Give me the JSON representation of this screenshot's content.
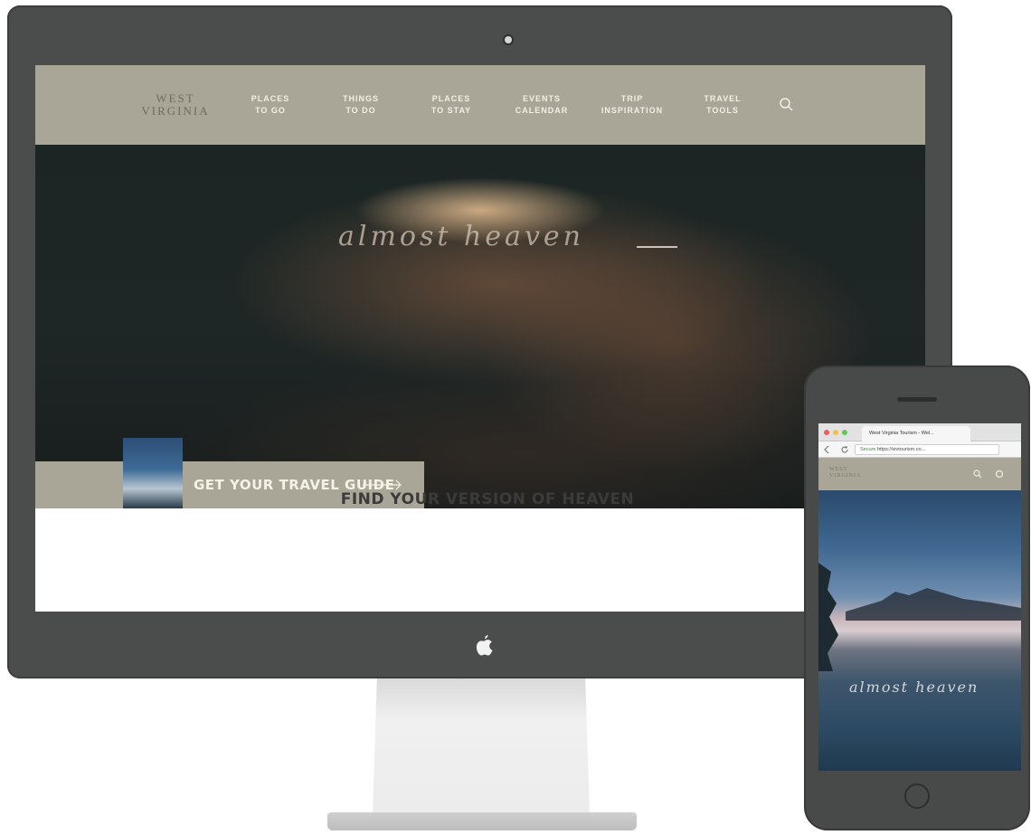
{
  "desktop": {
    "nav": {
      "logo_line1": "WEST",
      "logo_line2": "VIRGINIA",
      "items": [
        {
          "line1": "PLACES",
          "line2": "TO GO"
        },
        {
          "line1": "THINGS",
          "line2": "TO DO"
        },
        {
          "line1": "PLACES",
          "line2": "TO STAY"
        },
        {
          "line1": "EVENTS",
          "line2": "CALENDAR"
        },
        {
          "line1": "TRIP",
          "line2": "INSPIRATION"
        },
        {
          "line1": "TRAVEL",
          "line2": "TOOLS"
        }
      ],
      "search_icon": "search-icon"
    },
    "hero": {
      "script_text": "almost heaven"
    },
    "travel_guide": {
      "label": "GET YOUR TRAVEL GUIDE",
      "arrow_icon": "arrow-right-icon"
    },
    "section_heading": "FIND YOUR VERSION OF HEAVEN"
  },
  "mobile": {
    "browser": {
      "tab_title": "West Virginia Tourism - Wel...",
      "secure_label": "Secure",
      "url": "https://wvtourism.co..."
    },
    "nav": {
      "logo_line1": "WEST",
      "logo_line2": "VIRGINIA"
    },
    "hero": {
      "script_text": "almost heaven"
    }
  },
  "colors": {
    "nav_bg": "#a9a697",
    "device_frame": "#4a4d4b",
    "hero_dark": "#1b2523"
  }
}
